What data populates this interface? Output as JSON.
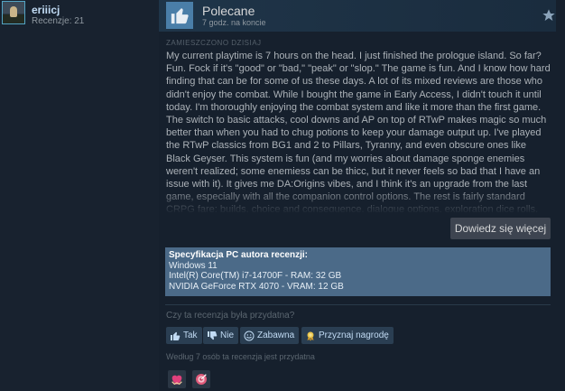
{
  "author": {
    "name": "eriiicj",
    "reviews": "Recenzje: 21"
  },
  "review": {
    "verdict": "Polecane",
    "time_on_record": "7 godz. na koncie",
    "posted": "ZAMIESZCZONO DZISIAJ",
    "text": "My current playtime is 7 hours on the head. I just finished the prologue island. So far? Fun. Fock if it's \"good\" or \"bad,\" \"peak\" or \"slop.\" The game is fun. And I know how hard finding that can be for some of us these days. A lot of its mixed reviews are those who didn't enjoy the combat. While I bought the game in Early Access, I didn't touch it until today. I'm thoroughly enjoying the combat system and like it more than the first game. The switch to basic attacks, cool downs and AP on top of RTwP makes magic so much better than when you had to chug potions to keep your damage output up. I've played the RTwP classics from BG1 and 2 to Pillars, Tyranny, and even obscure ones like Black Geyser. This system is fun (and my worries about damage sponge enemies weren't realized; some enemiess can be thicc, but it never feels so bad that I have an issue with it). It gives me DA:Origins vibes, and I think it's an upgrade from the last game, especially with all the companion control options. The rest is fairly standard CRPG fare: builds, choice and consequence, dialogue options, exploration dice rolls, etc., but it's presented in a competent package. The characters are all",
    "more_label": "Dowiedz się więcej"
  },
  "specs": {
    "title": "Specyfikacja PC autora recenzji:",
    "lines": [
      "Windows 11",
      "Intel(R) Core(TM) i7-14700F - RAM: 32 GB",
      "NVIDIA GeForce RTX 4070 - VRAM: 12 GB"
    ]
  },
  "feedback": {
    "question": "Czy ta recenzja była przydatna?",
    "yes": "Tak",
    "no": "Nie",
    "funny": "Zabawna",
    "award": "Przyznaj nagrodę",
    "helpful_count": "Według 7 osób ta recenzja jest przydatna"
  },
  "icons": {
    "thumb": "thumbs-up-icon",
    "star": "star-icon",
    "award1": "heart-hands-icon",
    "award2": "target-icon"
  },
  "colors": {
    "accent": "#4a7ea8",
    "specs_bg": "#4b6a88",
    "award1": "#e0407c",
    "award2": "#e05a7a"
  }
}
